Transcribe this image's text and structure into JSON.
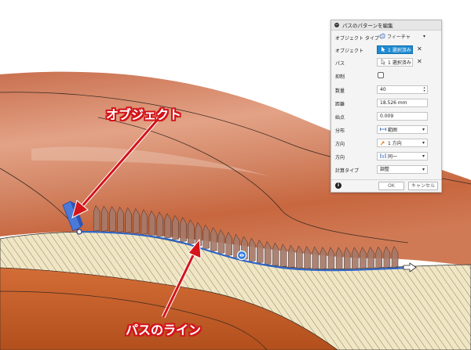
{
  "annotations": {
    "object_label": "オブジェクト",
    "path_line_label": "パスのライン"
  },
  "dialog": {
    "title": "パスのパターンを編集",
    "rows": {
      "object_type": {
        "label": "オブジェクト タイプ",
        "value": "フィーチャ"
      },
      "objects": {
        "label": "オブジェクト",
        "value": "1 選択済み"
      },
      "path": {
        "label": "パス",
        "value": "1 選択済み"
      },
      "suppress": {
        "label": "抑制"
      },
      "quantity": {
        "label": "数量",
        "value": "40"
      },
      "distance": {
        "label": "距離",
        "value": "18.526 mm"
      },
      "start_point": {
        "label": "始点",
        "value": "0.009"
      },
      "distribution": {
        "label": "分布",
        "value": "範囲"
      },
      "direction1": {
        "label": "方向",
        "value": "1 方向"
      },
      "direction2": {
        "label": "方向",
        "value": "同一"
      },
      "compute_type": {
        "label": "計算タイプ",
        "value": "調整"
      }
    },
    "ok_label": "OK",
    "cancel_label": "キャンセル"
  },
  "colors": {
    "surface_top": "#c9704b",
    "surface_light": "#e8a889",
    "hatch_fill": "#f2e7c4",
    "path_line": "#2f66c6",
    "annotation_red": "#d4141a",
    "selected_blue": "#1f8bd2"
  }
}
